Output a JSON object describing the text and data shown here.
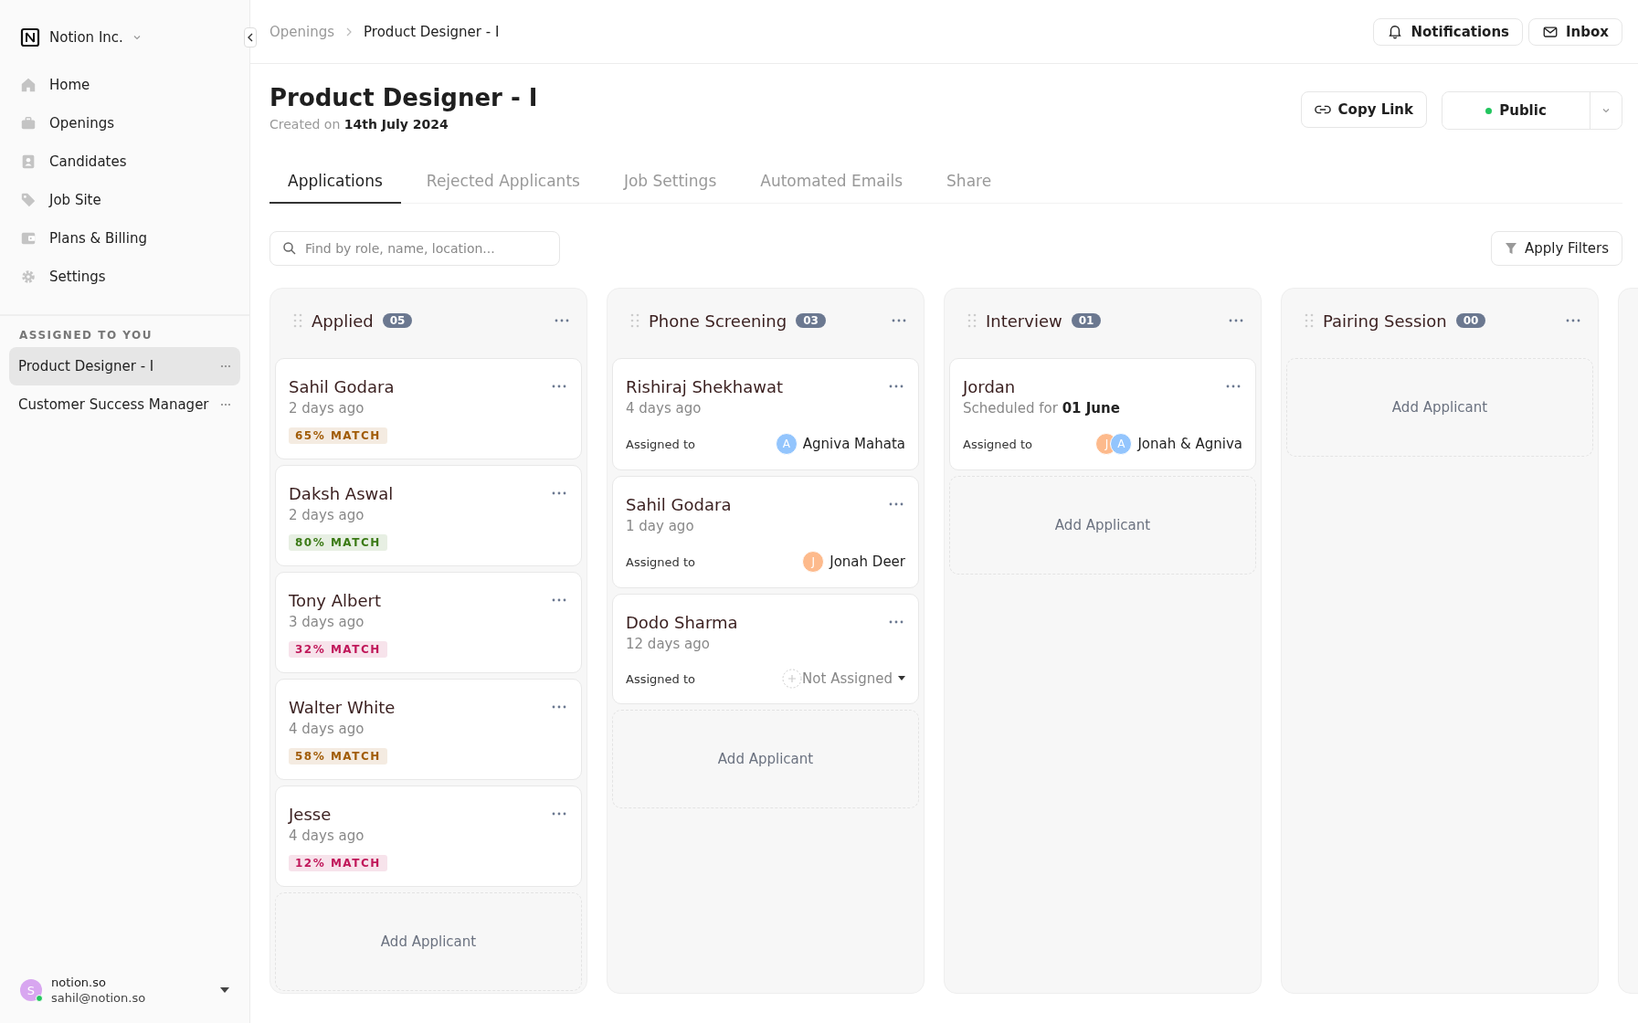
{
  "sidebar": {
    "workspace": "Notion Inc.",
    "nav": [
      {
        "label": "Home"
      },
      {
        "label": "Openings"
      },
      {
        "label": "Candidates"
      },
      {
        "label": "Job Site"
      },
      {
        "label": "Plans & Billing"
      },
      {
        "label": "Settings"
      }
    ],
    "section_title": "ASSIGNED TO YOU",
    "assigned": [
      {
        "label": "Product Designer - I",
        "selected": true
      },
      {
        "label": "Customer Success Manager",
        "selected": false
      }
    ],
    "user": {
      "initial": "S",
      "name": "notion.so",
      "email": "sahil@notion.so",
      "online": true
    }
  },
  "breadcrumb": [
    "Openings",
    "Product Designer - I"
  ],
  "top_actions": [
    {
      "label": "Notifications"
    },
    {
      "label": "Inbox"
    }
  ],
  "page": {
    "title": "Product Designer - I",
    "created": "Created on **14th July 2024**",
    "copy_link": "Copy Link",
    "visibility": "Public"
  },
  "tabs": [
    {
      "label": "Applications",
      "selected": true
    },
    {
      "label": "Rejected Applicants",
      "selected": false
    },
    {
      "label": "Job Settings",
      "selected": false
    },
    {
      "label": "Automated Emails",
      "selected": false
    },
    {
      "label": "Share",
      "selected": false
    }
  ],
  "search": {
    "placeholder": "Find by role, name, location..."
  },
  "filter_button": "Apply Filters",
  "columns": [
    {
      "title": "Applied",
      "count": "05",
      "add": "Add Applicant",
      "cards": [
        {
          "kind": "match",
          "name": "Sahil Godara",
          "time": "2 days ago",
          "match": "65% MATCH",
          "color": "#a15c07"
        },
        {
          "kind": "match",
          "name": "Daksh Aswal",
          "time": "2 days ago",
          "match": "80% MATCH",
          "color": "#3b7a16"
        },
        {
          "kind": "match",
          "name": "Tony Albert",
          "time": "3 days ago",
          "match": "32% MATCH",
          "color": "#c0185a"
        },
        {
          "kind": "match",
          "name": "Walter White",
          "time": "4 days ago",
          "match": "58% MATCH",
          "color": "#a15c07"
        },
        {
          "kind": "match",
          "name": "Jesse",
          "time": "4 days ago",
          "match": "12% MATCH",
          "color": "#c0185a"
        }
      ]
    },
    {
      "title": "Phone Screening",
      "count": "03",
      "add": "Add Applicant",
      "cards": [
        {
          "kind": "assigned",
          "name": "Rishiraj Shekhawat",
          "time": "4 days ago",
          "assigned_label": "Assigned to",
          "avatars": [
            {
              "initial": "A",
              "color": "#93c5fd"
            }
          ],
          "assignee": "Agniva Mahata"
        },
        {
          "kind": "assigned",
          "name": "Sahil Godara",
          "time": "1 day ago",
          "assigned_label": "Assigned to",
          "avatars": [
            {
              "initial": "J",
              "color": "#fdba8c"
            }
          ],
          "assignee": "Jonah Deer"
        },
        {
          "kind": "unassigned",
          "name": "Dodo Sharma",
          "time": "12 days ago",
          "assigned_label": "Assigned to",
          "assignee": "Not Assigned"
        }
      ]
    },
    {
      "title": "Interview",
      "count": "01",
      "add": "Add Applicant",
      "cards": [
        {
          "kind": "assigned",
          "name": "Jordan",
          "time": "Scheduled for **01 June**",
          "assigned_label": "Assigned to",
          "avatars": [
            {
              "initial": "J",
              "color": "#fdba8c"
            },
            {
              "initial": "A",
              "color": "#93c5fd"
            }
          ],
          "assignee": "Jonah & Agniva"
        }
      ]
    },
    {
      "title": "Pairing Session",
      "count": "00",
      "add": "Add Applicant"
    }
  ]
}
